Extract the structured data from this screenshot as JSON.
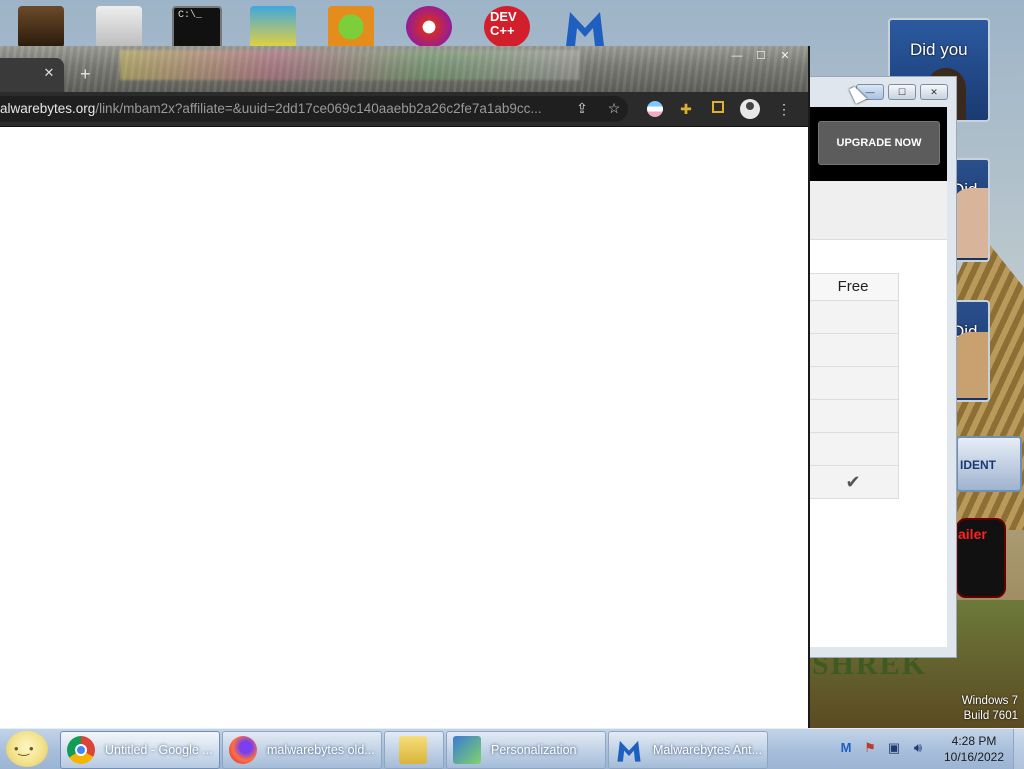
{
  "desktop": {
    "icons": [
      "figure-icon",
      "paper-icon",
      "cmd-icon",
      "among-us-icon",
      "angry-birds-icon",
      "paint-icon",
      "dev-cpp-icon",
      "malwarebytes-icon"
    ],
    "icon_text": {
      "dev_cpp": "DEV\nC++"
    },
    "gadget_texts": [
      "Did you",
      "Did you",
      "Did you"
    ],
    "gadget_badge": "IDENT",
    "gadget_ad": "ailer",
    "watermark_line1": "Windows 7",
    "watermark_line2": "Build 7601",
    "shrek_text": "SHREK"
  },
  "chrome": {
    "tab_close": "✕",
    "new_tab": "+",
    "url_domain": "alwarebytes.org",
    "url_path": "/link/mbam2x?affiliate=&uuid=2dd17ce069c140aaebb2a26c2fe7a1ab9cc...",
    "window_controls": {
      "min": "—",
      "max": "☐",
      "close": "✕"
    },
    "toolbar_icons": [
      "share-icon",
      "star-icon",
      "extension-flag-icon",
      "puzzle-icon",
      "sidebar-icon",
      "profile-icon",
      "menu-icon"
    ]
  },
  "malwarebytes": {
    "upgrade_label": "UPGRADE NOW",
    "compare_header": "Free",
    "compare_rows": [
      "",
      "",
      "",
      "",
      "",
      "✔"
    ],
    "title_controls": {
      "min": "—",
      "max": "☐",
      "close": "✕"
    }
  },
  "taskbar": {
    "tasks": [
      {
        "label": "Untitled - Google ...",
        "icon": "chrome-icon"
      },
      {
        "label": "malwarebytes old...",
        "icon": "firefox-icon"
      },
      {
        "label": "",
        "icon": "folder-icon"
      },
      {
        "label": "Personalization",
        "icon": "personalization-icon"
      },
      {
        "label": "Malwarebytes Ant...",
        "icon": "malwarebytes-icon"
      }
    ],
    "tray_icons": [
      "malwarebytes-tray-icon",
      "flag-icon",
      "network-icon",
      "volume-icon"
    ],
    "time": "4:28 PM",
    "date": "10/16/2022"
  },
  "colors": {
    "chrome_toolbar": "#2b2b2b",
    "mb_header": "#000000",
    "upgrade_button": "#5c5c5c",
    "taskbar": "#a9c0dc"
  }
}
